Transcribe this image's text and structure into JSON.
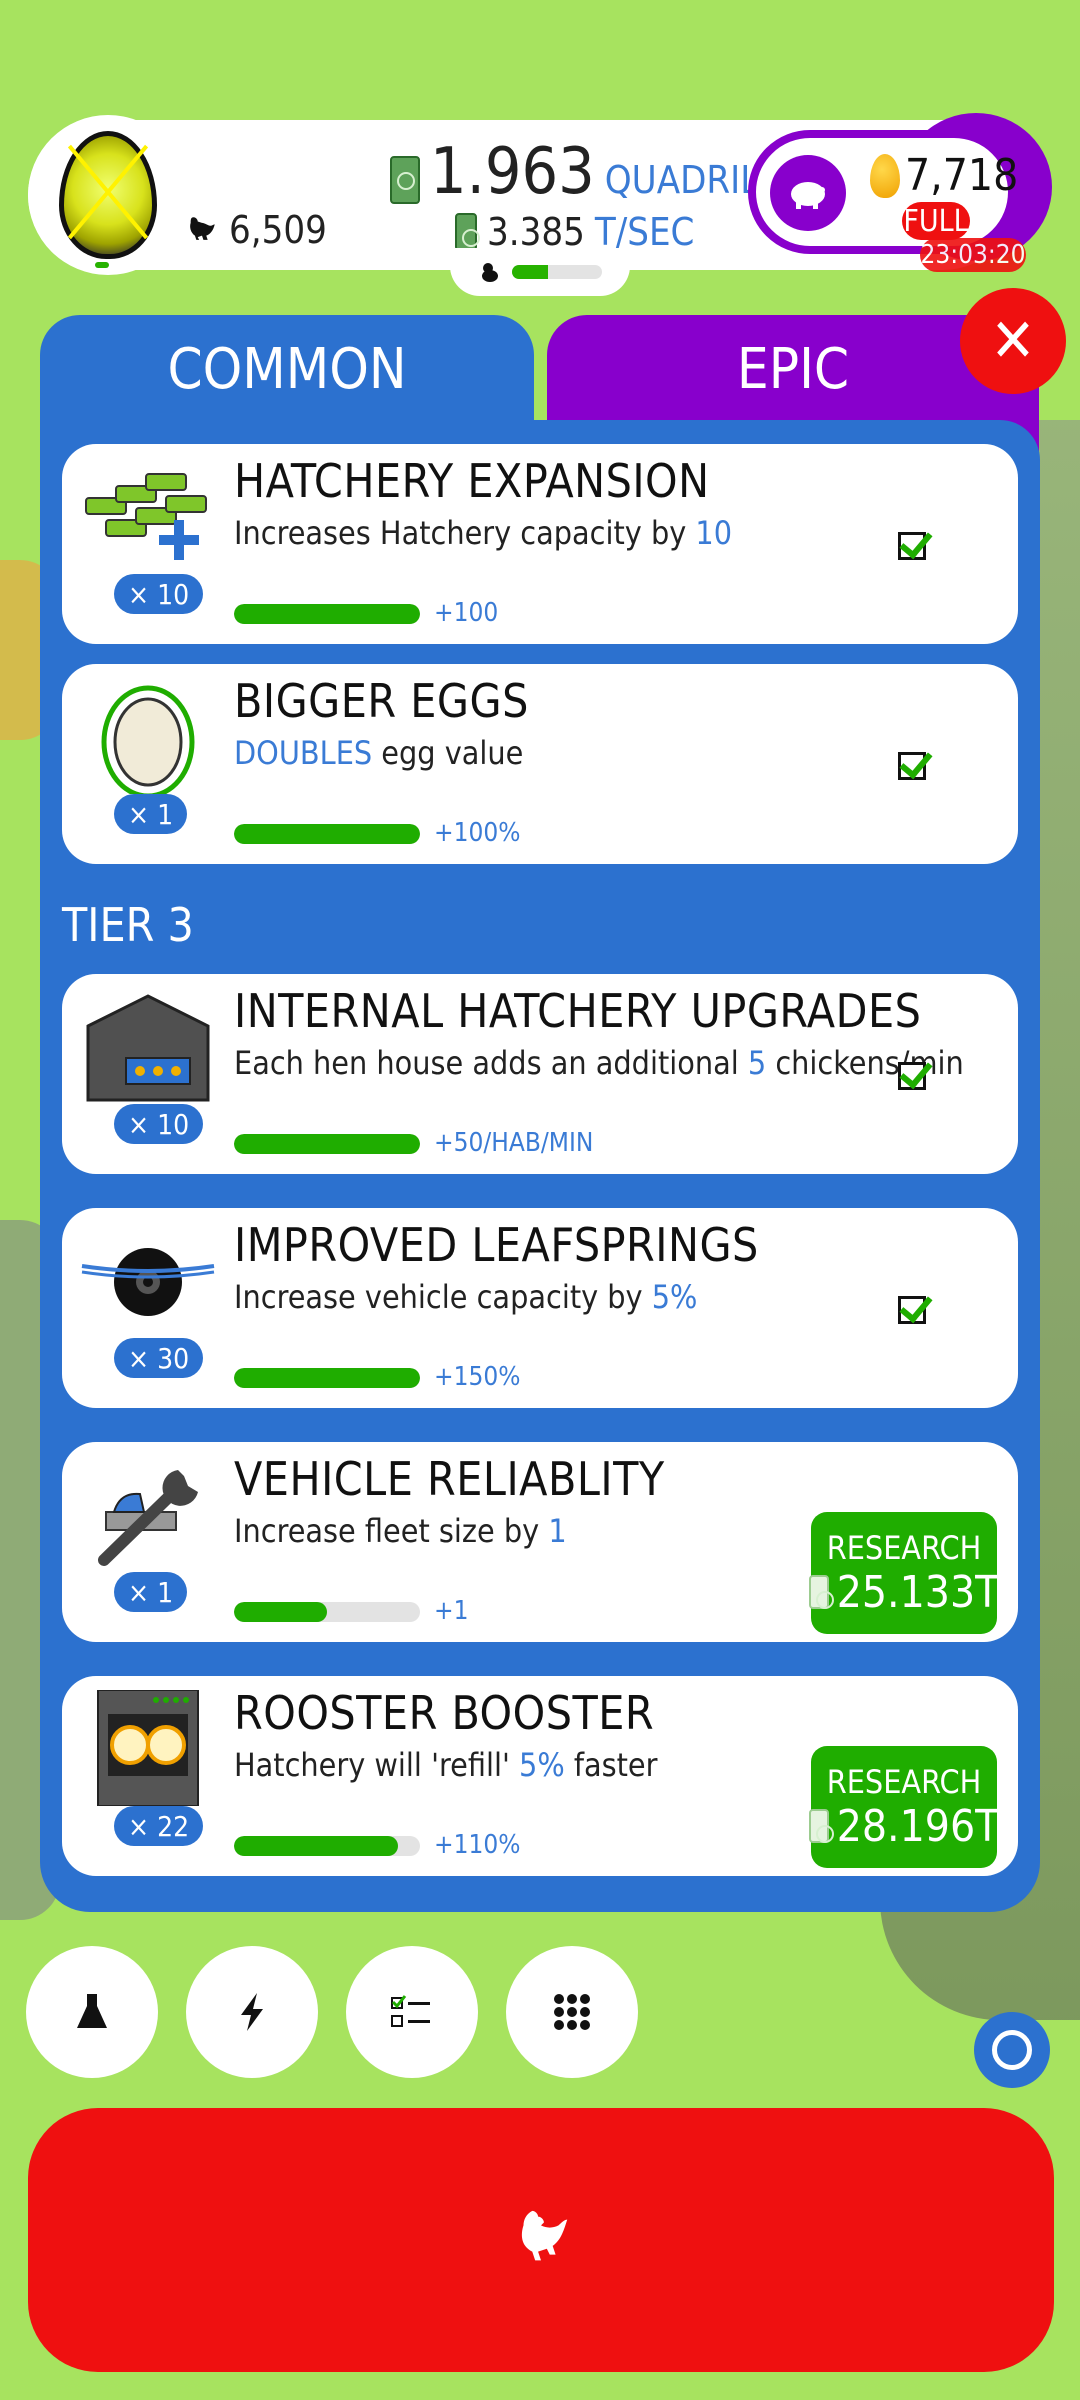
{
  "hud": {
    "chicken_count": "6,509",
    "money_value": "1.963",
    "money_unit": "QUADRILLION",
    "rate_value": "3.385",
    "rate_unit": "T/SEC",
    "golden_eggs": "7,718",
    "piggy_status": "FULL",
    "timer": "23:03:20"
  },
  "tabs": {
    "common": "COMMON",
    "epic": "EPIC"
  },
  "tier_label": "TIER 3",
  "cards": [
    {
      "title": "HATCHERY EXPANSION",
      "desc_prefix": "Increases Hatchery capacity by ",
      "desc_value": "10",
      "desc_suffix": "",
      "count": "× 10",
      "bonus": "+100",
      "progress": 1.0,
      "status": "complete"
    },
    {
      "title": "BIGGER EGGS",
      "desc_prefix": "",
      "desc_value": "DOUBLES",
      "desc_suffix": " egg value",
      "count": "× 1",
      "bonus": "+100%",
      "progress": 1.0,
      "status": "complete"
    },
    {
      "title": "INTERNAL HATCHERY UPGRADES",
      "desc_prefix": "Each hen house adds an additional ",
      "desc_value": "5",
      "desc_suffix": " chickens/min",
      "count": "× 10",
      "bonus": "+50/HAB/MIN",
      "progress": 1.0,
      "status": "complete"
    },
    {
      "title": "IMPROVED LEAFSPRINGS",
      "desc_prefix": "Increase vehicle capacity by ",
      "desc_value": "5%",
      "desc_suffix": "",
      "count": "× 30",
      "bonus": "+150%",
      "progress": 1.0,
      "status": "complete"
    },
    {
      "title": "VEHICLE RELIABLITY",
      "desc_prefix": "Increase fleet size by ",
      "desc_value": "1",
      "desc_suffix": "",
      "count": "× 1",
      "bonus": "+1",
      "progress": 0.5,
      "status": "research",
      "research_label": "RESEARCH",
      "cost": "25.133T"
    },
    {
      "title": "ROOSTER BOOSTER",
      "desc_prefix": "Hatchery will 'refill' ",
      "desc_value": "5%",
      "desc_suffix": " faster",
      "count": "× 22",
      "bonus": "+110%",
      "progress": 0.88,
      "status": "research",
      "research_label": "RESEARCH",
      "cost": "28.196T"
    }
  ],
  "icons": {
    "nav": [
      "flask-icon",
      "lightning-icon",
      "checklist-icon",
      "grid-icon"
    ],
    "main": "chicken-icon"
  },
  "colors": {
    "accent_blue": "#2c71cf",
    "epic_purple": "#8800cc",
    "action_red": "#ef1010",
    "progress_green": "#1fad00",
    "background": "#a7e35f"
  }
}
